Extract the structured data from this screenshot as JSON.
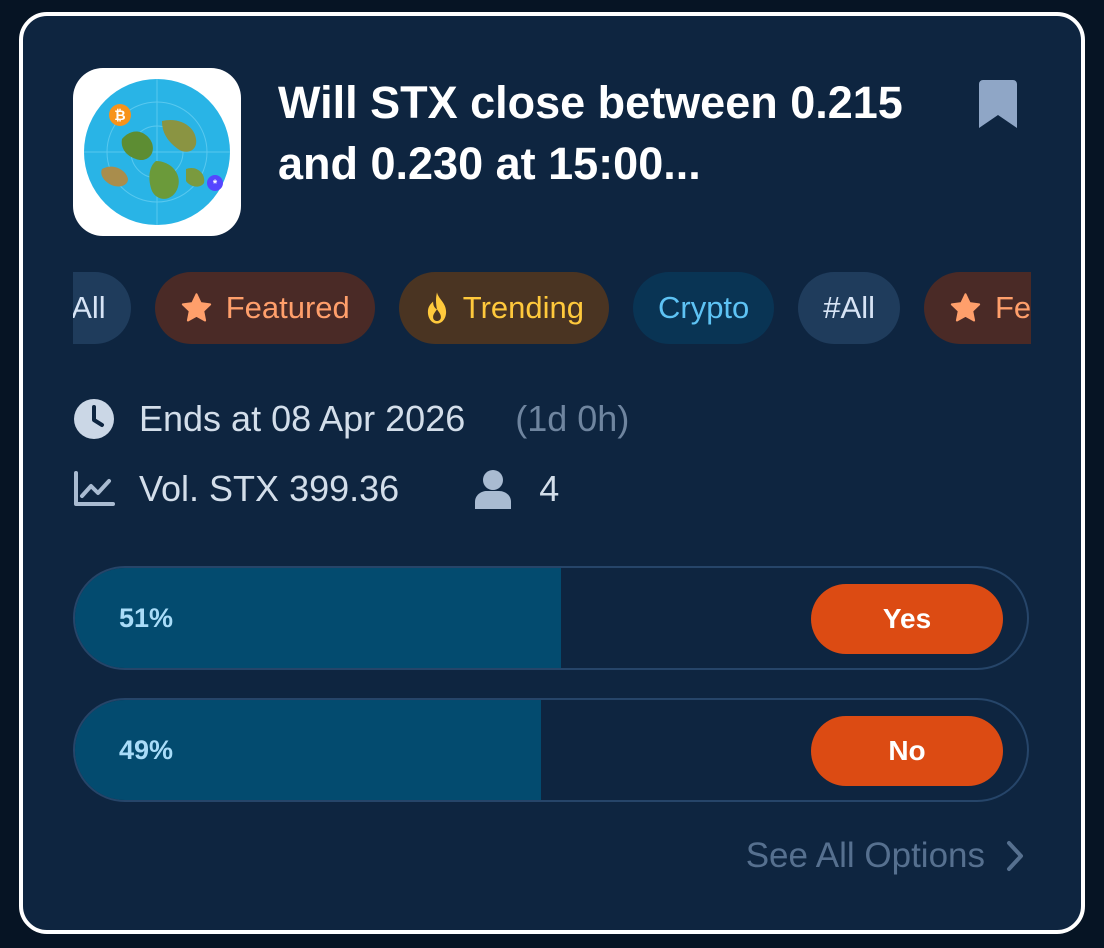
{
  "market": {
    "title": "Will STX close between 0.215 and 0.230 at 15:00...",
    "icon": "globe-map-image"
  },
  "tags": [
    {
      "label": "#All",
      "icon": ""
    },
    {
      "label": "Featured",
      "icon": "star-icon"
    },
    {
      "label": "Trending",
      "icon": "fire-icon"
    },
    {
      "label": "Crypto",
      "icon": ""
    },
    {
      "label": "#All",
      "icon": ""
    },
    {
      "label": "Featured",
      "icon": "star-icon"
    }
  ],
  "meta": {
    "ends_label": "Ends at 08 Apr 2026",
    "remaining": "(1d 0h)",
    "volume_label": "Vol. STX 399.36",
    "participants": "4"
  },
  "options": [
    {
      "percent_label": "51%",
      "fraction": 0.51,
      "button_label": "Yes"
    },
    {
      "percent_label": "49%",
      "fraction": 0.49,
      "button_label": "No"
    }
  ],
  "see_all_label": "See All Options",
  "colors": {
    "background": "#061424",
    "card": "#0e2540",
    "accent": "#dc4b13",
    "fill": "#034b6f"
  }
}
